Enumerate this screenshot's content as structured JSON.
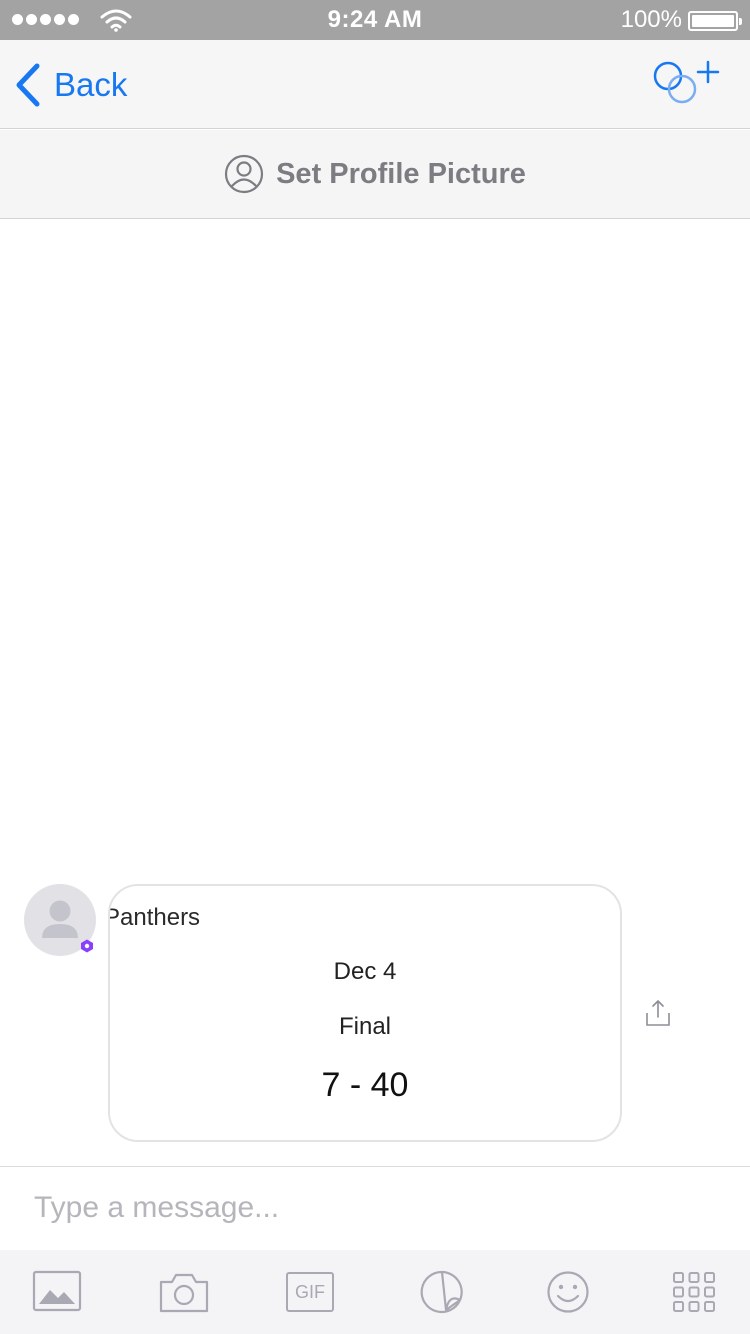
{
  "status_bar": {
    "time": "9:24 AM",
    "battery_percent": "100%",
    "signal_bars": 5
  },
  "nav": {
    "back_label": "Back",
    "icons": {
      "back": "chevron-left-icon",
      "add_people": "add-people-icon"
    }
  },
  "profile_banner": {
    "label": "Set Profile Picture",
    "icon": "person-outline-icon"
  },
  "message": {
    "team": "Panthers",
    "date": "Dec 4",
    "status": "Final",
    "score": "7 - 40",
    "share_icon": "share-icon"
  },
  "composer": {
    "placeholder": "Type a message...",
    "value": ""
  },
  "toolbar": {
    "gif_label": "GIF",
    "items": [
      "photo-icon",
      "camera-icon",
      "gif-icon",
      "sticker-icon",
      "emoji-icon",
      "apps-grid-icon"
    ]
  },
  "colors": {
    "accent": "#1878f2",
    "status_bar": "#a3a3a3",
    "toolbar_icon": "#a9a9b4",
    "badge": "#8a3ffc"
  }
}
